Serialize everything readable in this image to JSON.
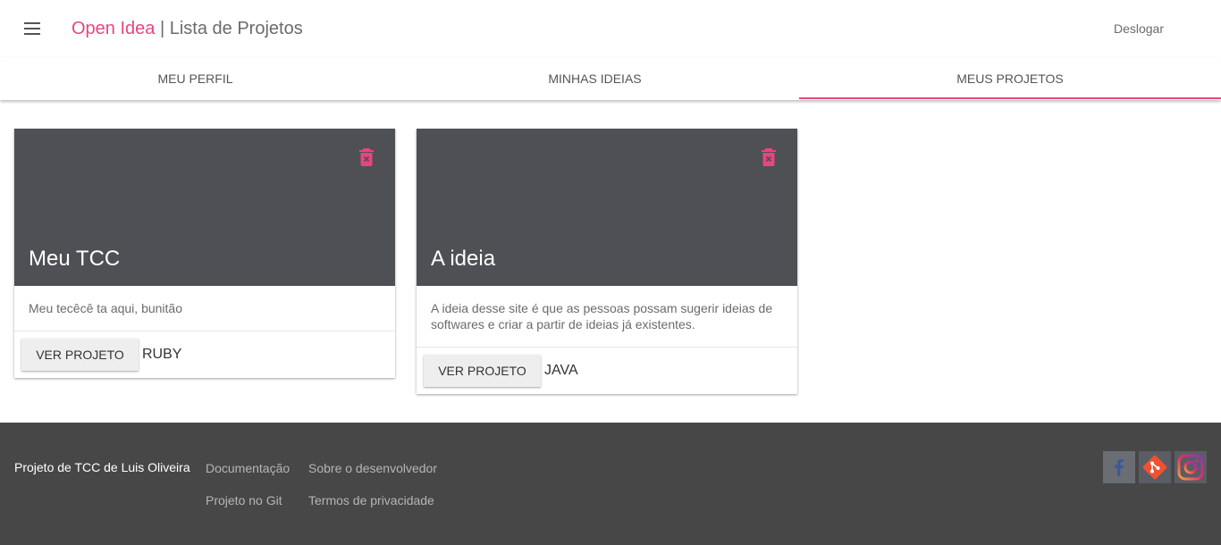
{
  "appbar": {
    "menu_icon": "menu-icon",
    "brand": "Open Idea",
    "separator": " | ",
    "page_title": "Lista de Projetos",
    "logout_label": "Deslogar"
  },
  "tabs": [
    {
      "label": "MEU PERFIL",
      "active": false
    },
    {
      "label": "MINHAS IDEIAS",
      "active": false
    },
    {
      "label": "MEUS PROJETOS",
      "active": true
    }
  ],
  "projects": [
    {
      "title": "Meu TCC",
      "description": "Meu tecêcê ta aqui, bunitão",
      "button_label": "VER PROJETO",
      "language": "RUBY",
      "delete_icon": "delete-forever-icon"
    },
    {
      "title": "A ideia",
      "description": "A ideia desse site é que as pessoas possam sugerir ideias de softwares e criar a partir de ideias já existentes.",
      "button_label": "VER PROJETO",
      "language": "JAVA",
      "delete_icon": "delete-forever-icon"
    }
  ],
  "footer": {
    "credit": "Projeto de TCC de Luis Oliveira",
    "links": [
      "Documentação",
      "Sobre o desenvolvedor",
      "Projeto no Git",
      "Termos de privacidade"
    ],
    "social_icons": [
      "facebook-icon",
      "git-icon",
      "instagram-icon"
    ]
  },
  "colors": {
    "accent": "#e8457f",
    "card_media": "#4e5056",
    "footer_bg": "#474747"
  }
}
